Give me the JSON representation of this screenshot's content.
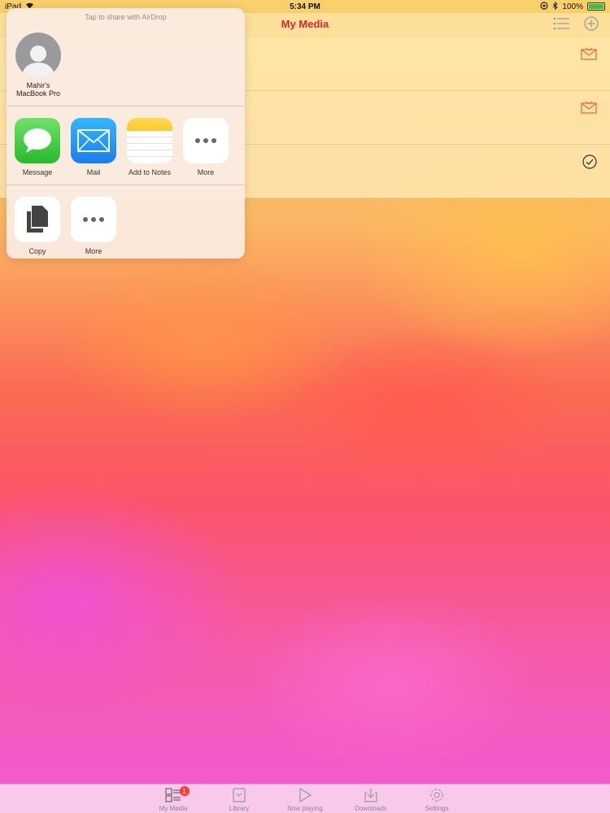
{
  "status_bar": {
    "device": "iPad",
    "time": "5:34 PM",
    "battery": "100%",
    "battery_level": 1.0
  },
  "nav": {
    "title": "My Media",
    "list_icon": "list-icon",
    "add_icon": "add-circle-icon"
  },
  "list_rows": [
    {
      "icon": "mail-icon"
    },
    {
      "icon": "mail-icon"
    },
    {
      "icon": "checkmark-circle-icon"
    }
  ],
  "share_sheet": {
    "airdrop_hint": "Tap to share with AirDrop",
    "airdrop_target": "Mahir's\nMacBook Pro",
    "apps": [
      {
        "label": "Message",
        "icon": "message-icon"
      },
      {
        "label": "Mail",
        "icon": "mail-icon"
      },
      {
        "label": "Add to Notes",
        "icon": "notes-icon"
      },
      {
        "label": "More",
        "icon": "more-icon"
      }
    ],
    "actions": [
      {
        "label": "Copy",
        "icon": "copy-icon"
      },
      {
        "label": "More",
        "icon": "more-icon"
      }
    ]
  },
  "tab_bar": {
    "tabs": [
      {
        "label": "My Media",
        "icon": "my-media-icon",
        "badge": "1"
      },
      {
        "label": "Library",
        "icon": "library-icon"
      },
      {
        "label": "Now playing",
        "icon": "play-icon"
      },
      {
        "label": "Downloads",
        "icon": "downloads-icon"
      },
      {
        "label": "Settings",
        "icon": "settings-icon"
      }
    ]
  },
  "colors": {
    "accent": "#d8242b",
    "badge": "#ff3b30"
  }
}
